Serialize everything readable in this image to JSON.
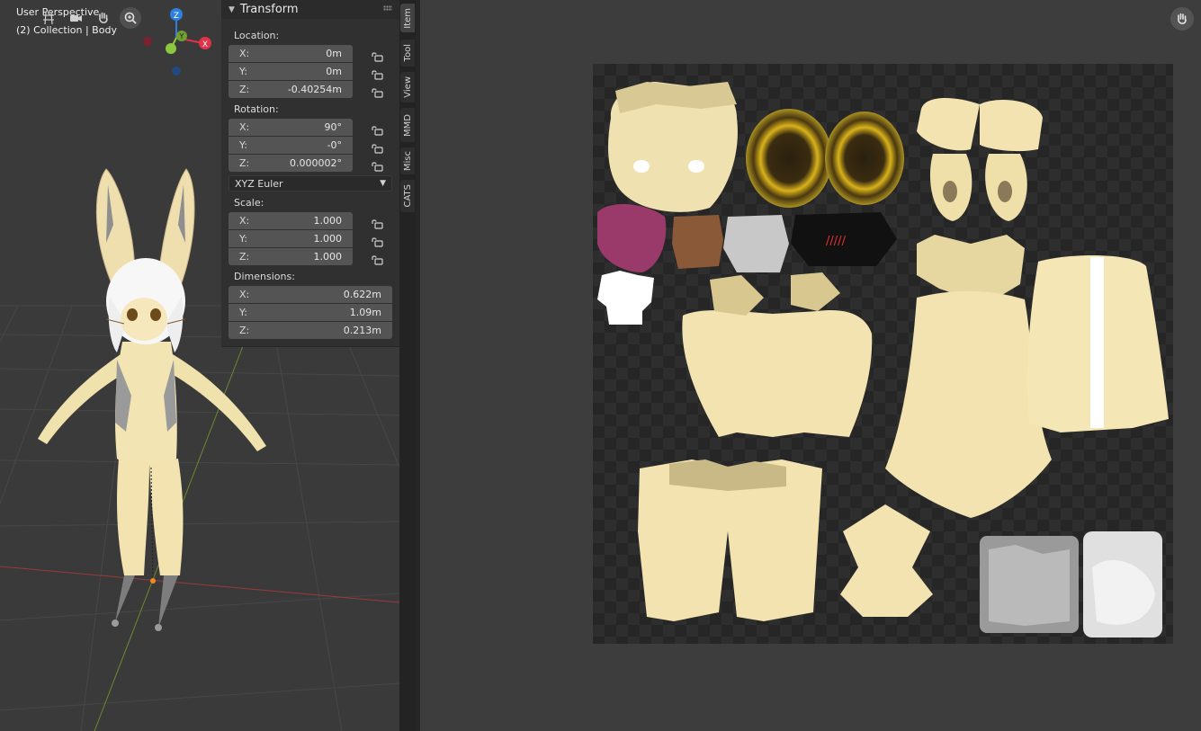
{
  "viewport": {
    "title": "User Perspective",
    "collection": "(2) Collection | Body",
    "nav_icons": [
      "grid-icon",
      "camera-icon",
      "hand-icon",
      "zoom-icon"
    ],
    "gizmo": {
      "z": "Z",
      "y": "Y",
      "x": "X",
      "colors": {
        "x": "#e0334a",
        "y": "#8dc63f",
        "z": "#2f7fe0"
      }
    }
  },
  "transform": {
    "header": "Transform",
    "location": {
      "label": "Location:",
      "x": {
        "axis": "X:",
        "value": "0m"
      },
      "y": {
        "axis": "Y:",
        "value": "0m"
      },
      "z": {
        "axis": "Z:",
        "value": "-0.40254m"
      }
    },
    "rotation": {
      "label": "Rotation:",
      "x": {
        "axis": "X:",
        "value": "90°"
      },
      "y": {
        "axis": "Y:",
        "value": "-0°"
      },
      "z": {
        "axis": "Z:",
        "value": "0.000002°"
      }
    },
    "rotation_mode": "XYZ Euler",
    "scale": {
      "label": "Scale:",
      "x": {
        "axis": "X:",
        "value": "1.000"
      },
      "y": {
        "axis": "Y:",
        "value": "1.000"
      },
      "z": {
        "axis": "Z:",
        "value": "1.000"
      }
    },
    "dimensions": {
      "label": "Dimensions:",
      "x": {
        "axis": "X:",
        "value": "0.622m"
      },
      "y": {
        "axis": "Y:",
        "value": "1.09m"
      },
      "z": {
        "axis": "Z:",
        "value": "0.213m"
      }
    }
  },
  "tabs": [
    {
      "label": "Item",
      "active": true
    },
    {
      "label": "Tool",
      "active": false
    },
    {
      "label": "View",
      "active": false
    },
    {
      "label": "MMD",
      "active": false
    },
    {
      "label": "Misc",
      "active": false
    },
    {
      "label": "CATS",
      "active": false
    }
  ],
  "uv_editor": {
    "texture_marking": "/////",
    "colors": {
      "fur": "#f2e3b0",
      "background": "#3d3d3d"
    }
  }
}
